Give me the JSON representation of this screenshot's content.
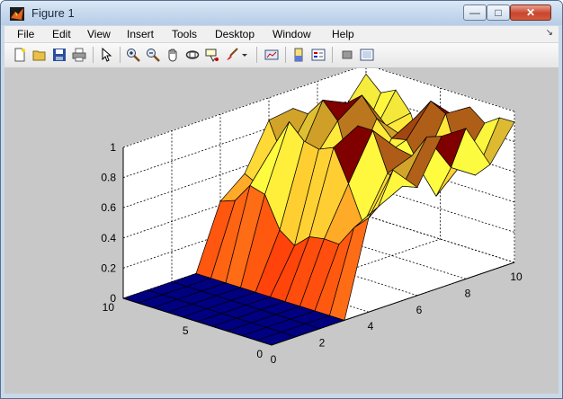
{
  "window": {
    "title": "Figure 1",
    "controls": {
      "minimize": "—",
      "maximize": "□",
      "close": "✕"
    }
  },
  "menubar": {
    "items": [
      "File",
      "Edit",
      "View",
      "Insert",
      "Tools",
      "Desktop",
      "Window",
      "Help"
    ]
  },
  "toolbar": {
    "buttons": [
      "new-figure-icon",
      "open-file-icon",
      "save-icon",
      "print-icon",
      "pointer-icon",
      "zoom-in-icon",
      "zoom-out-icon",
      "pan-hand-icon",
      "rotate-3d-icon",
      "data-cursor-icon",
      "brush-icon",
      "brush-dropdown-icon",
      "link-plot-icon",
      "colorbar-icon",
      "legend-icon",
      "hide-plot-tools-icon",
      "show-plot-tools-icon"
    ]
  },
  "chart_data": {
    "type": "surface",
    "title": "",
    "xlabel": "",
    "ylabel": "",
    "zlabel": "",
    "x_ticks": [
      "0",
      "2",
      "4",
      "6",
      "8",
      "10"
    ],
    "y_ticks": [
      "0",
      "5",
      "10"
    ],
    "z_ticks": [
      "0",
      "0.2",
      "0.4",
      "0.6",
      "0.8",
      "1"
    ],
    "xlim": [
      0,
      10
    ],
    "ylim": [
      0,
      10
    ],
    "zlim": [
      0,
      1
    ],
    "grid": true,
    "colormap": "hot",
    "x": [
      0,
      1,
      2,
      3,
      4,
      5,
      6,
      7,
      8,
      9,
      10
    ],
    "y": [
      0,
      1,
      2,
      3,
      4,
      5,
      6,
      7,
      8,
      9,
      10
    ],
    "colors": {
      "low": "#000080",
      "mid": "#ff2000",
      "high": "#ffff40",
      "peak": "#800000"
    }
  }
}
